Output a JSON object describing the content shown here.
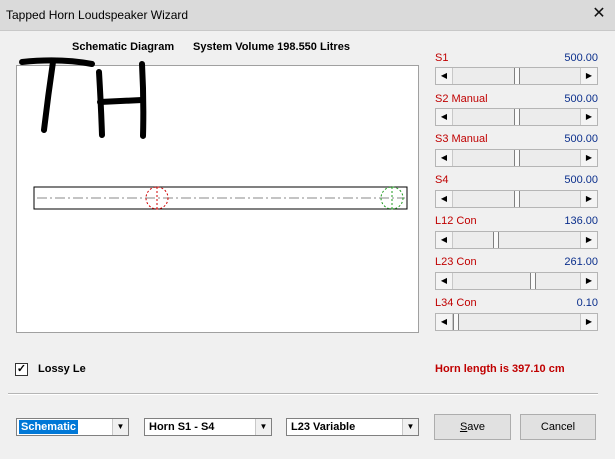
{
  "window": {
    "title": "Tapped Horn Loudspeaker Wizard",
    "close_glyph": "✕"
  },
  "header": {
    "schematic_label": "Schematic Diagram",
    "volume_label": "System Volume 198.550 Litres"
  },
  "sketch_text": "TH",
  "params": [
    {
      "label": "S1",
      "value": "500.00",
      "level": 0.5
    },
    {
      "label": "S2  Manual",
      "value": "500.00",
      "level": 0.5
    },
    {
      "label": "S3  Manual",
      "value": "500.00",
      "level": 0.5
    },
    {
      "label": "S4",
      "value": "500.00",
      "level": 0.5
    },
    {
      "label": "L12  Con",
      "value": "136.00",
      "level": 0.33
    },
    {
      "label": "L23  Con",
      "value": "261.00",
      "level": 0.64
    },
    {
      "label": "L34  Con",
      "value": "0.10",
      "level": 0.0
    }
  ],
  "lossy": {
    "label": "Lossy Le",
    "checked": true,
    "check_glyph": "✓"
  },
  "horn_length_text": "Horn length is 397.10 cm",
  "dropdowns": {
    "view": "Schematic",
    "section": "Horn S1 - S4",
    "variable": "L23 Variable",
    "arrow_glyph": "▼"
  },
  "buttons": {
    "save_first": "S",
    "save_rest": "ave",
    "cancel": "Cancel"
  },
  "colors": {
    "label_red": "#c00000",
    "value_blue": "#0b2f8c",
    "selection": "#0078d7"
  }
}
